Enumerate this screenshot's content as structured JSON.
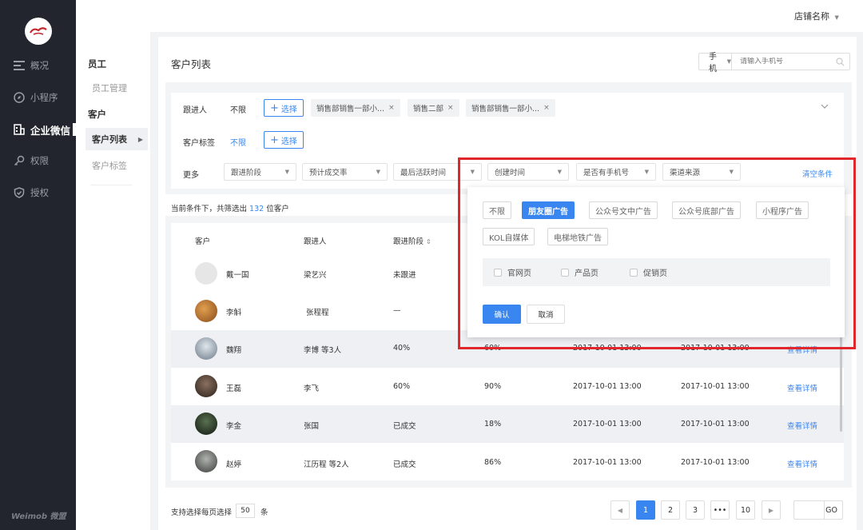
{
  "header": {
    "store_name": "店铺名称"
  },
  "brand": "Weimob 微盟",
  "sidebar": {
    "items": [
      {
        "label": "概况",
        "icon": "dashboard-icon"
      },
      {
        "label": "小程序",
        "icon": "compass-icon"
      },
      {
        "label": "企业微信",
        "icon": "building-icon",
        "active": true
      },
      {
        "label": "权限",
        "icon": "key-icon"
      },
      {
        "label": "授权",
        "icon": "shield-check-icon"
      }
    ]
  },
  "submenu": {
    "groups": [
      {
        "title": "员工",
        "items": [
          {
            "label": "员工管理"
          }
        ]
      },
      {
        "title": "客户",
        "items": [
          {
            "label": "客户列表",
            "active": true
          },
          {
            "label": "客户标签"
          }
        ]
      }
    ]
  },
  "page": {
    "title": "客户列表"
  },
  "search": {
    "type": "手机",
    "placeholder": "请输入手机号"
  },
  "filters": {
    "follower": {
      "label": "跟进人",
      "unlimited": "不限",
      "select_label": "选择",
      "tags": [
        "销售部销售一部小...",
        "销售二部",
        "销售部销售一部小..."
      ]
    },
    "customer_tag": {
      "label": "客户标签",
      "unlimited": "不限",
      "select_label": "选择"
    },
    "more": {
      "label": "更多",
      "dropdowns": [
        "跟进阶段",
        "预计成交率",
        "最后活跃时间",
        "",
        "创建时间",
        "是否有手机号",
        "渠道来源"
      ],
      "clear_label": "清空条件"
    }
  },
  "summary": {
    "prefix": "当前条件下，共筛选出",
    "count": "132",
    "suffix": "位客户"
  },
  "table": {
    "headers": [
      "客户",
      "跟进人",
      "跟进阶段",
      "",
      "",
      "",
      ""
    ],
    "detail_label": "查看详情",
    "rows": [
      {
        "name": "戴一国",
        "follower": "梁艺兴",
        "stage": "未跟进",
        "rate": "",
        "created": "",
        "active": "",
        "detail": "",
        "avatar": "#dcdcdc"
      },
      {
        "name": "李斛",
        "follower": "张程程",
        "stage": "—",
        "rate": "",
        "created": "",
        "active": "",
        "detail": "",
        "avatar": "#a8632a"
      },
      {
        "name": "魏翔",
        "follower": "李博 等3人",
        "stage": "40%",
        "rate": "60%",
        "created": "2017-10-01 13:00",
        "active": "2017-10-01 13:00",
        "detail": "查看详情",
        "avatar": "#9aa8b4"
      },
      {
        "name": "王磊",
        "follower": "李飞",
        "stage": "60%",
        "rate": "90%",
        "created": "2017-10-01 13:00",
        "active": "2017-10-01 13:00",
        "detail": "查看详情",
        "avatar": "#4a3a30"
      },
      {
        "name": "李金",
        "follower": "张国",
        "stage": "已成交",
        "rate": "18%",
        "created": "2017-10-01 13:00",
        "active": "2017-10-01 13:00",
        "detail": "查看详情",
        "avatar": "#2d3a2a"
      },
      {
        "name": "赵婷",
        "follower": "江历程 等2人",
        "stage": "已成交",
        "rate": "86%",
        "created": "2017-10-01 13:00",
        "active": "2017-10-01 13:00",
        "detail": "查看详情",
        "avatar": "#6a6c6a"
      }
    ]
  },
  "pagination": {
    "perpage_label": "支持选择每页选择",
    "perpage_value": "50",
    "perpage_unit": "条",
    "pages": [
      "1",
      "2",
      "3",
      "•••",
      "10"
    ],
    "current": "1",
    "go_label": "GO"
  },
  "channel_dropdown": {
    "chips_row1": [
      "不限",
      "朋友圈广告",
      "公众号文中广告",
      "公众号底部广告",
      "小程序广告"
    ],
    "chips_row2": [
      "KOL自媒体",
      "电梯地铁广告"
    ],
    "selected": "朋友圈广告",
    "sub_options": [
      "官网页",
      "产品页",
      "促销页"
    ],
    "confirm_label": "确认",
    "cancel_label": "取消"
  },
  "colors": {
    "accent": "#3a86f0",
    "sidebar_bg": "#23252e",
    "highlight_frame": "#e0282c"
  }
}
